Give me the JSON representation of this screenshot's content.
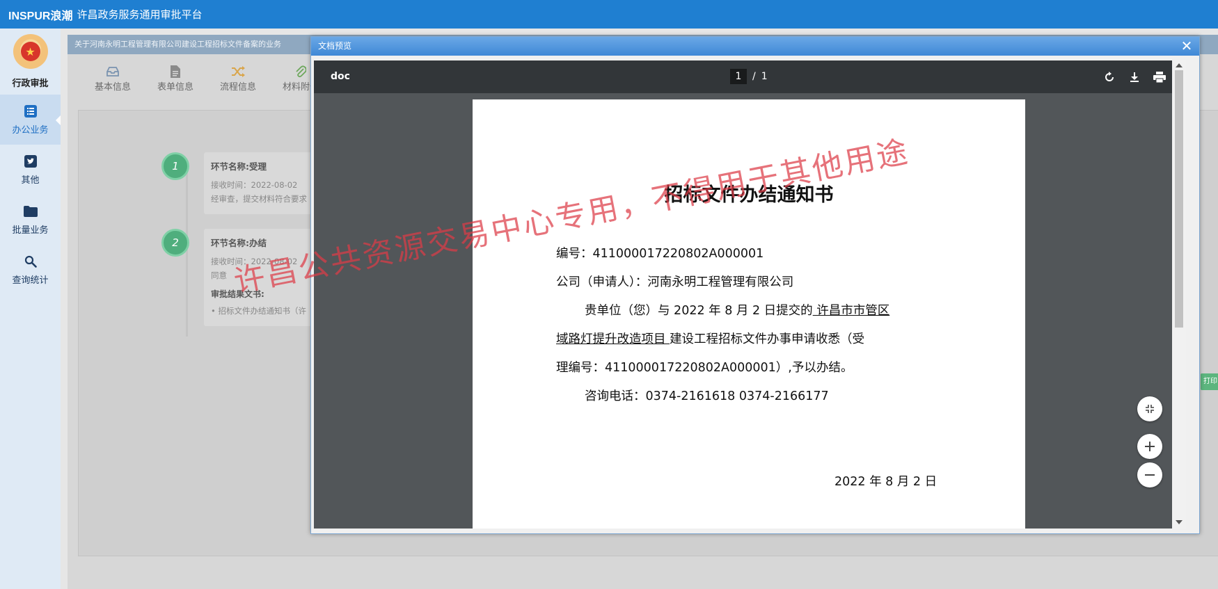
{
  "topbar": {
    "brand": "INSPUR浪潮",
    "title": "许昌政务服务通用审批平台"
  },
  "sidebar": {
    "logo_label": "行政审批",
    "items": [
      {
        "label": "办公业务",
        "icon": "list-icon",
        "active": true
      },
      {
        "label": "其他",
        "icon": "twitter-icon",
        "active": false
      },
      {
        "label": "批量业务",
        "icon": "folder-icon",
        "active": false
      },
      {
        "label": "查询统计",
        "icon": "search-icon",
        "active": false
      }
    ]
  },
  "business": {
    "header": "关于河南永明工程管理有限公司建设工程招标文件备案的业务",
    "tabs": [
      {
        "label": "基本信息",
        "icon": "inbox-icon"
      },
      {
        "label": "表单信息",
        "icon": "file-icon"
      },
      {
        "label": "流程信息",
        "icon": "shuffle-icon"
      },
      {
        "label": "材料附件",
        "icon": "paperclip-icon"
      }
    ],
    "steps": [
      {
        "num": "1",
        "name": "环节名称:受理",
        "time": "接收时间：2022-08-02",
        "note": "经审查，提交材料符合要求"
      },
      {
        "num": "2",
        "name": "环节名称:办结",
        "time": "接收时间：2022-08-02",
        "note": "同意",
        "result_label": "审批结果文书:",
        "result_item": "• 招标文件办结通知书（许"
      }
    ],
    "side_button": "打印"
  },
  "modal": {
    "title": "文档预览",
    "close": "✕",
    "viewer": {
      "filename": "doc",
      "page_current": "1",
      "page_sep": "/",
      "page_total": "1"
    },
    "document": {
      "title": "招标文件办结通知书",
      "number_line": "编号：411000017220802A000001",
      "company_line": "公司（申请人）：河南永明工程管理有限公司",
      "body_1a": "贵单位（您）与 2022 年 8 月 2 日提交的",
      "body_1b": "    许昌市市管区",
      "body_2a": "域路灯提升改造项目    ",
      "body_2b": "建设工程招标文件办事申请收悉（受",
      "body_3": "理编号：411000017220802A000001）,予以办结。",
      "phone": "咨询电话：0374-2161618    0374-2166177",
      "date": "2022 年 8 月 2 日"
    }
  },
  "watermark": "许昌公共资源交易中心专用，不得用于其他用途"
}
